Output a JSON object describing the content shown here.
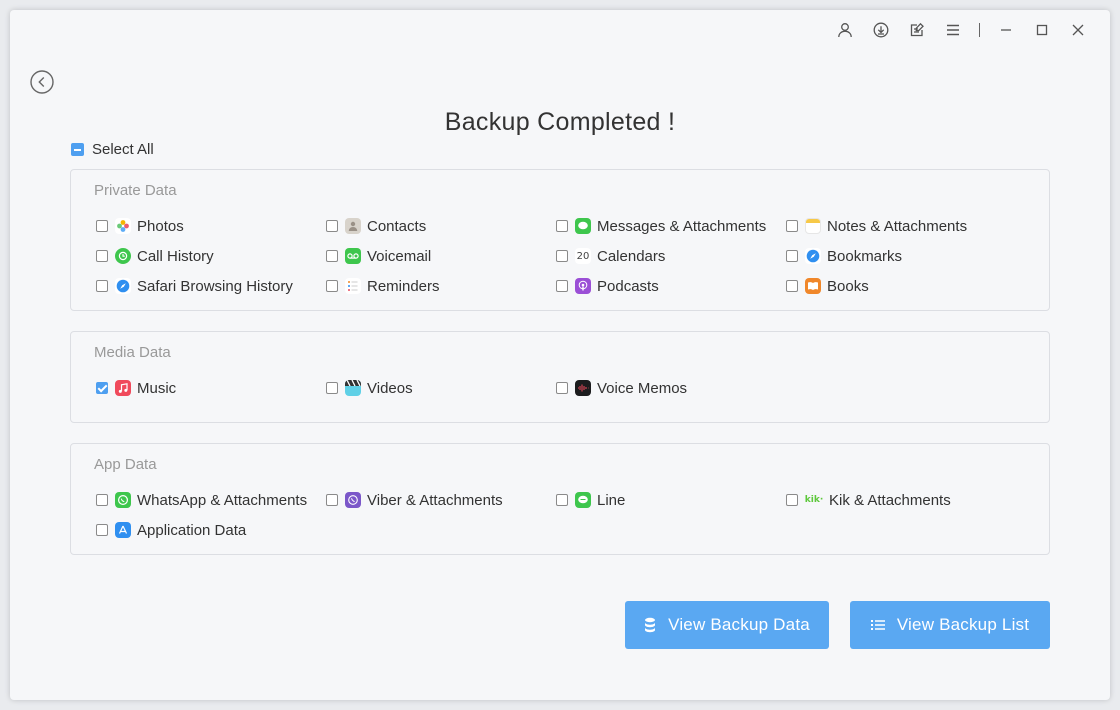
{
  "page": {
    "title": "Backup Completed !",
    "select_all": "Select All"
  },
  "panels": {
    "private": {
      "title": "Private Data",
      "items": [
        {
          "label": "Photos",
          "icon": "photos-icon",
          "checked": false
        },
        {
          "label": "Contacts",
          "icon": "contacts-icon",
          "checked": false
        },
        {
          "label": "Messages & Attachments",
          "icon": "messages-icon",
          "checked": false
        },
        {
          "label": "Notes & Attachments",
          "icon": "notes-icon",
          "checked": false
        },
        {
          "label": "Call History",
          "icon": "call-history-icon",
          "checked": false
        },
        {
          "label": "Voicemail",
          "icon": "voicemail-icon",
          "checked": false
        },
        {
          "label": "Calendars",
          "icon": "calendars-icon",
          "checked": false,
          "icon_text": "20"
        },
        {
          "label": "Bookmarks",
          "icon": "bookmarks-icon",
          "checked": false
        },
        {
          "label": "Safari Browsing History",
          "icon": "safari-icon",
          "checked": false
        },
        {
          "label": "Reminders",
          "icon": "reminders-icon",
          "checked": false
        },
        {
          "label": "Podcasts",
          "icon": "podcasts-icon",
          "checked": false
        },
        {
          "label": "Books",
          "icon": "books-icon",
          "checked": false
        }
      ]
    },
    "media": {
      "title": "Media Data",
      "items": [
        {
          "label": "Music",
          "icon": "music-icon",
          "checked": true
        },
        {
          "label": "Videos",
          "icon": "videos-icon",
          "checked": false
        },
        {
          "label": "Voice Memos",
          "icon": "voice-memos-icon",
          "checked": false
        }
      ]
    },
    "app": {
      "title": "App Data",
      "items": [
        {
          "label": "WhatsApp & Attachments",
          "icon": "whatsapp-icon",
          "checked": false
        },
        {
          "label": "Viber & Attachments",
          "icon": "viber-icon",
          "checked": false
        },
        {
          "label": "Line",
          "icon": "line-icon",
          "checked": false
        },
        {
          "label": "Kik & Attachments",
          "icon": "kik-icon",
          "checked": false,
          "icon_text": "kik·"
        },
        {
          "label": "Application Data",
          "icon": "app-store-icon",
          "checked": false
        }
      ]
    }
  },
  "buttons": {
    "view_backup_data": "View Backup Data",
    "view_backup_list": "View Backup List"
  },
  "colors": {
    "accent": "#5aa8f2",
    "checkbox_checked": "#4e9ff0"
  }
}
